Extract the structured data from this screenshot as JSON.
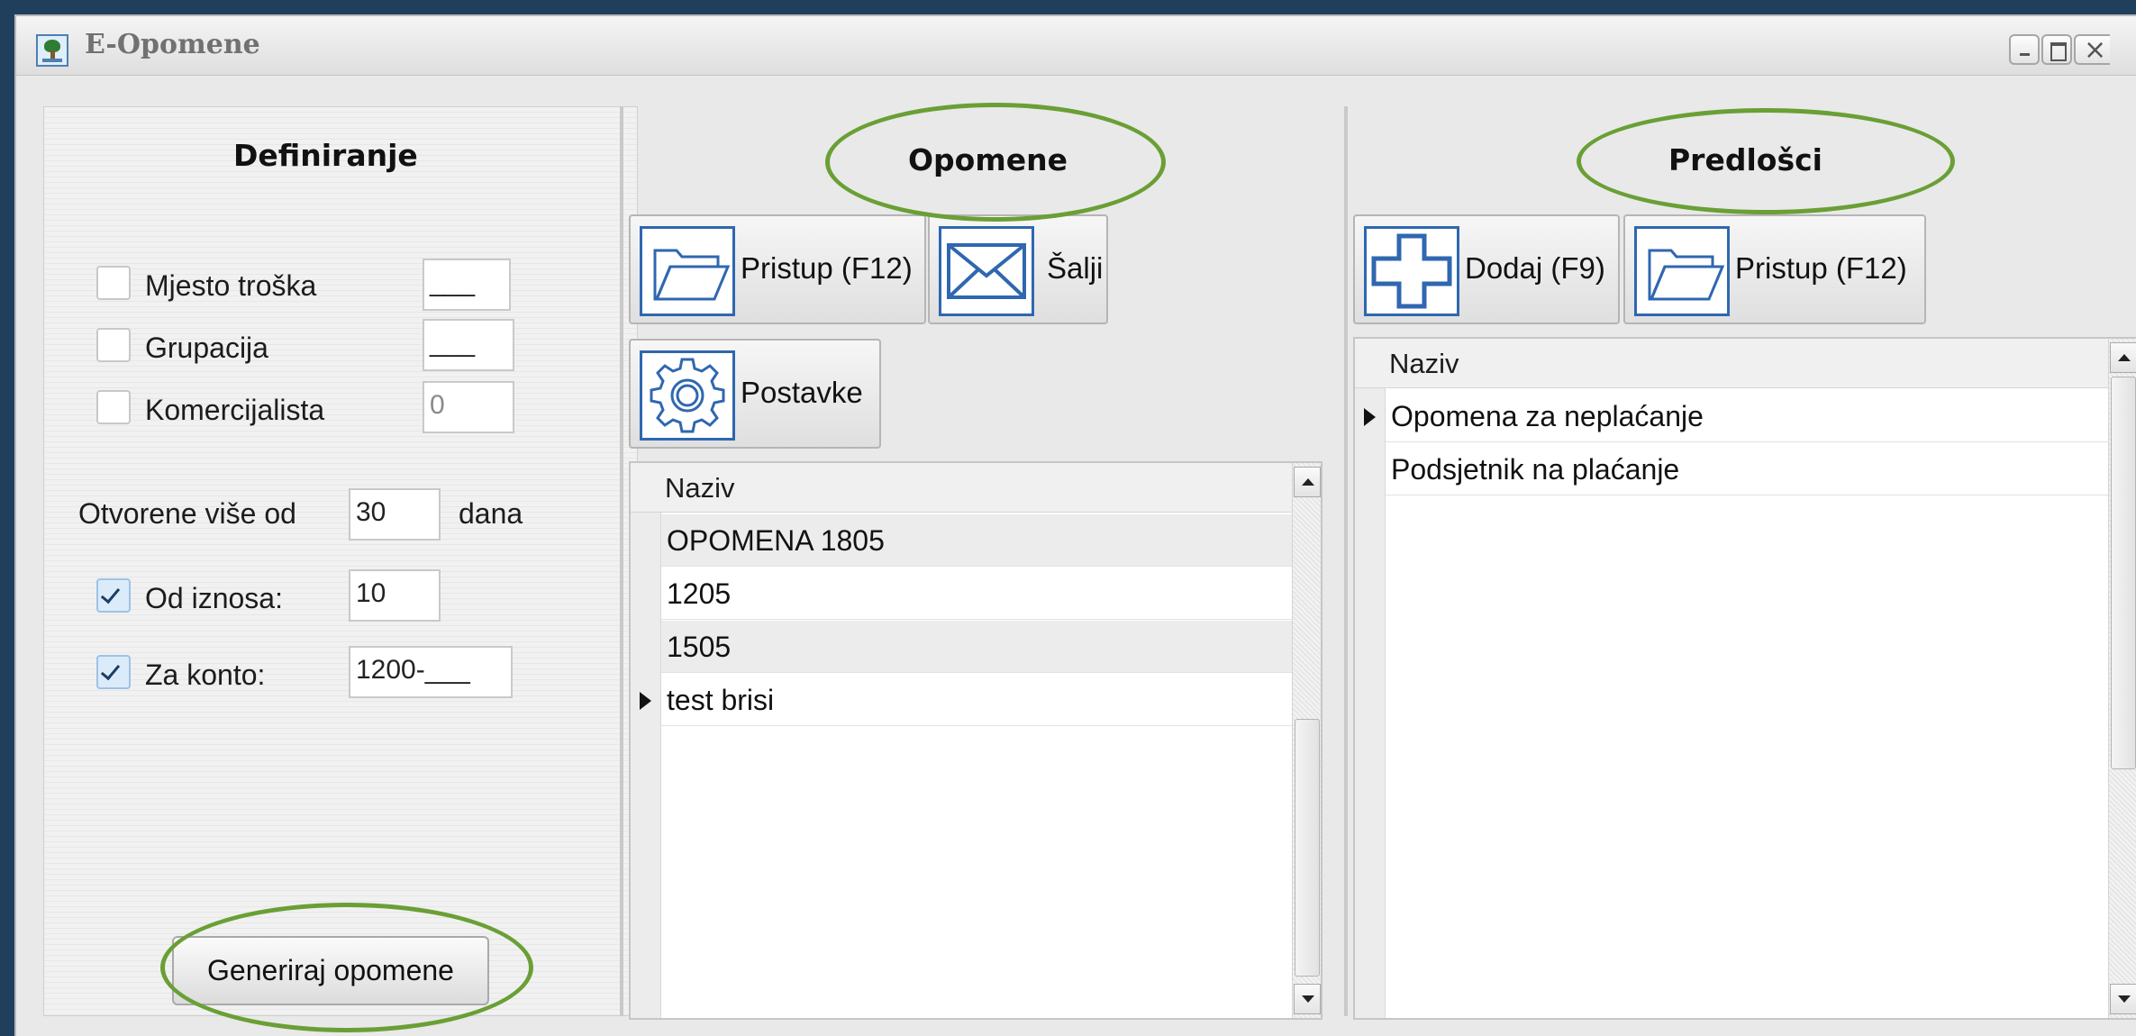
{
  "window": {
    "title": "E-Opomene",
    "icon": "app-tree-icon",
    "controls": [
      "minimize-icon",
      "maximize-icon",
      "close-icon"
    ]
  },
  "left_panel": {
    "title": "Definiranje",
    "filters": [
      {
        "label": "Mjesto troška",
        "checked": false,
        "value": "___"
      },
      {
        "label": "Grupacija",
        "checked": false,
        "value": "___"
      },
      {
        "label": "Komercijalista",
        "checked": false,
        "value": "0"
      }
    ],
    "open_more_than": {
      "label": "Otvorene više od",
      "value": "30",
      "unit": "dana"
    },
    "from_amount": {
      "label": "Od iznosa:",
      "checked": true,
      "value": "10"
    },
    "for_account": {
      "label": "Za konto:",
      "checked": true,
      "value": "1200-___"
    },
    "generate_button": "Generiraj opomene"
  },
  "middle_panel": {
    "title": "Opomene",
    "buttons": {
      "access": "Pristup (F12)",
      "send": "Šalji",
      "settings": "Postavke"
    },
    "grid": {
      "header": "Naziv",
      "rows": [
        "OPOMENA 1805",
        "1205",
        "1505",
        "test brisi"
      ],
      "current_row": 3
    }
  },
  "right_panel": {
    "title": "Predlošci",
    "buttons": {
      "add": "Dodaj (F9)",
      "access": "Pristup (F12)"
    },
    "grid": {
      "header": "Naziv",
      "rows": [
        "Opomena za neplaćanje",
        "Podsjetnik na plaćanje"
      ],
      "current_row": 0
    }
  },
  "colors": {
    "background": "#1f3f5c",
    "highlight_ellipse": "#6a9f35",
    "icon_blue": "#2f67b0"
  }
}
